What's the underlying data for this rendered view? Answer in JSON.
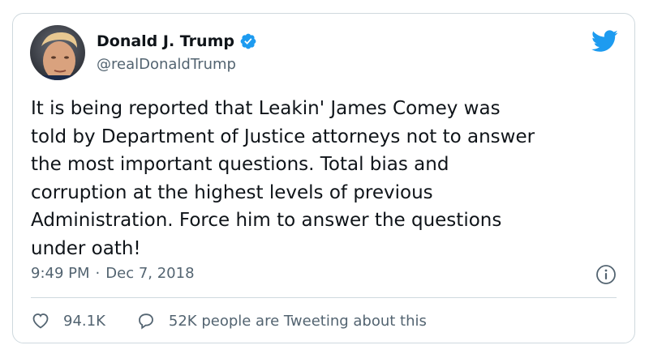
{
  "author": {
    "name": "Donald J. Trump",
    "handle": "@realDonaldTrump",
    "verified": true
  },
  "tweet": {
    "text": "It is being reported that Leakin' James Comey was\ntold by Department of Justice attorneys not to answer\nthe most important questions. Total bias and\ncorruption at the highest levels of previous\nAdministration. Force him to answer the questions\nunder oath!",
    "time": "9:49 PM",
    "separator": "·",
    "date": "Dec 7, 2018"
  },
  "actions": {
    "likes": "94.1K",
    "conversation": "52K people are Tweeting about this"
  },
  "colors": {
    "twitter_blue": "#1d9bf0",
    "text_primary": "#0f1419",
    "text_secondary": "#536471",
    "border": "#cfd9de"
  },
  "icons": {
    "verified": "verified-badge-icon",
    "brand": "twitter-bird-icon",
    "info": "info-icon",
    "like": "heart-icon",
    "reply": "speech-bubble-icon"
  }
}
